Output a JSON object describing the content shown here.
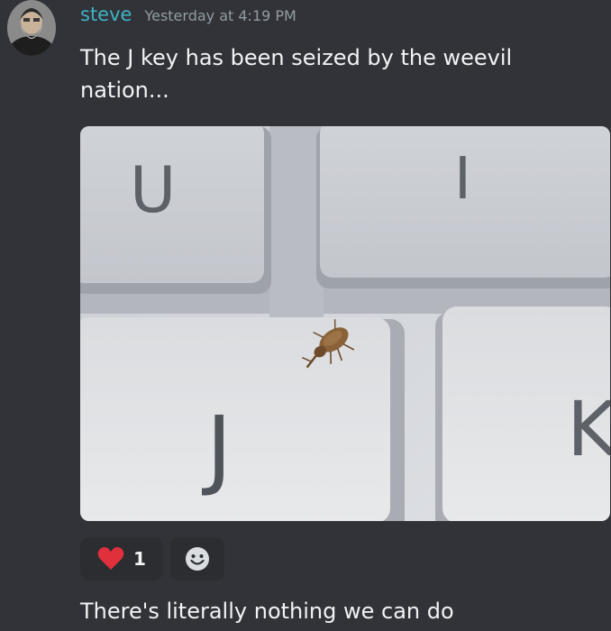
{
  "message": {
    "author": "steve",
    "timestamp": "Yesterday at 4:19 PM",
    "text": "The J key has been seized by the weevil nation...",
    "avatar_icon": "bearded-man-avatar",
    "attachment": {
      "keys": [
        "U",
        "I",
        "J",
        "K"
      ]
    },
    "reactions": [
      {
        "icon": "heart-icon",
        "count": "1"
      },
      {
        "icon": "add-reaction-icon"
      }
    ]
  },
  "followup_message": {
    "text": "There's literally nothing we can do"
  },
  "colors": {
    "background": "#313338",
    "username": "#3fb4c5",
    "timestamp": "#949ba4",
    "text": "#f2f3f5",
    "reaction_bg": "#2b2d31",
    "heart": "#e0303b"
  }
}
